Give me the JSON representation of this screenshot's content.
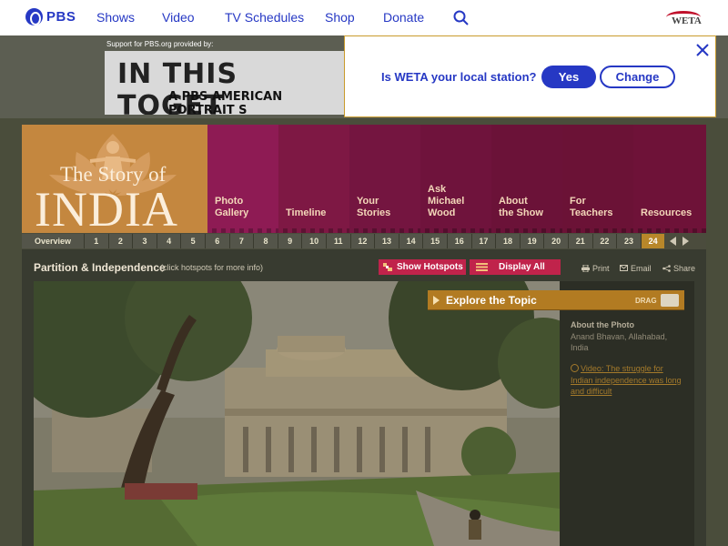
{
  "pbs_nav": {
    "logo_text": "PBS",
    "links": [
      "Shows",
      "Video",
      "TV Schedules",
      "Shop",
      "Donate"
    ],
    "station_logo_text": "WETA"
  },
  "ad": {
    "support_text": "Support for PBS.org provided by:",
    "headline": "IN THIS TOGET",
    "subline": "A PBS AMERICAN PORTRAIT S"
  },
  "station_popup": {
    "question": "Is WETA your local station?",
    "yes_label": "Yes",
    "change_label": "Change"
  },
  "show": {
    "logo_small": "The Story of",
    "logo_big": "INDIA",
    "tabs": [
      {
        "label": "Photo\nGallery",
        "color": "#8e1b54"
      },
      {
        "label": "Timeline",
        "color": "#7e1844"
      },
      {
        "label": "Your\nStories",
        "color": "#741540"
      },
      {
        "label": "Ask\nMichael\nWood",
        "color": "#6f133c"
      },
      {
        "label": "About\nthe Show",
        "color": "#6b1238"
      },
      {
        "label": "For\nTeachers",
        "color": "#6b1236"
      },
      {
        "label": "Resources",
        "color": "#6e1238"
      }
    ]
  },
  "numbar": {
    "overview_label": "Overview",
    "numbers": [
      "1",
      "2",
      "3",
      "4",
      "5",
      "6",
      "7",
      "8",
      "9",
      "10",
      "11",
      "12",
      "13",
      "14",
      "15",
      "16",
      "17",
      "18",
      "19",
      "20",
      "21",
      "22",
      "23",
      "24"
    ],
    "active": "24"
  },
  "section": {
    "title": "Partition & Independence",
    "hint": "(click hotspots for more info)",
    "hotspots_label": "Show Hotspots",
    "display_label": "Display All",
    "print_label": "Print",
    "email_label": "Email",
    "share_label": "Share"
  },
  "explore": {
    "label": "Explore the Topic",
    "drag_label": "DRAG"
  },
  "about": {
    "heading": "About the Photo",
    "location": "Anand Bhavan, Allahabad, India",
    "video_text": "Video: The struggle for Indian independence was long and difficult"
  }
}
